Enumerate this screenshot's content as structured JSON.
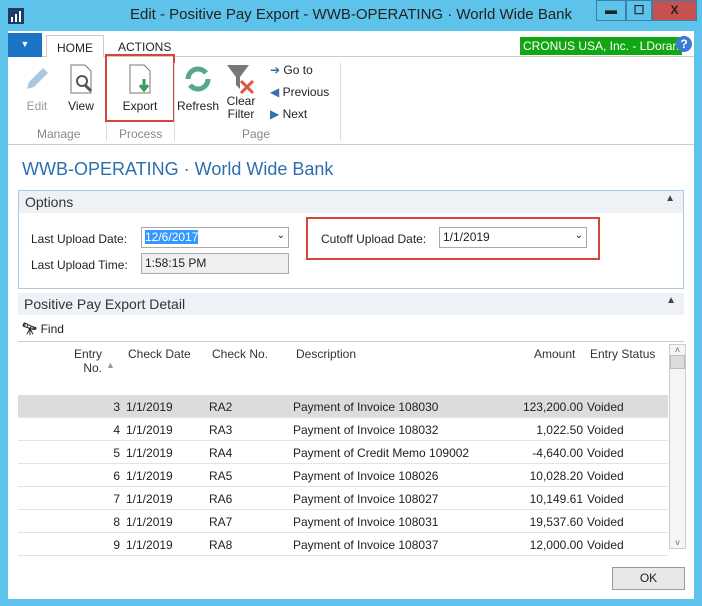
{
  "window": {
    "title": "Edit - Positive Pay Export - WWB-OPERATING · World Wide Bank",
    "minimize": "▬",
    "maximize": "☐",
    "close": "X"
  },
  "ribbon": {
    "tabs": [
      {
        "label": "HOME",
        "active": true
      },
      {
        "label": "ACTIONS",
        "active": false
      }
    ],
    "company": "CRONUS USA, Inc. - LDoran",
    "help": "?",
    "buttons": {
      "edit": "Edit",
      "view": "View",
      "export": "Export",
      "refresh": "Refresh",
      "clear_filter": "Clear Filter",
      "goto": "Go to",
      "previous": "Previous",
      "next": "Next"
    },
    "groups": {
      "manage": "Manage",
      "process": "Process",
      "page": "Page"
    }
  },
  "page_title": "WWB-OPERATING · World Wide Bank",
  "options": {
    "header": "Options",
    "last_upload_date_label": "Last Upload Date:",
    "last_upload_date": "12/6/2017",
    "last_upload_time_label": "Last Upload Time:",
    "last_upload_time": "1:58:15 PM",
    "cutoff_label": "Cutoff Upload Date:",
    "cutoff": "1/1/2019"
  },
  "detail": {
    "header": "Positive Pay Export Detail",
    "find": "Find",
    "columns": {
      "entry_no": "Entry No.",
      "check_date": "Check Date",
      "check_no": "Check No.",
      "description": "Description",
      "amount": "Amount",
      "status": "Entry Status"
    },
    "rows": [
      {
        "entry": "3",
        "date": "1/1/2019",
        "check": "RA2",
        "desc": "Payment of Invoice 108030",
        "amount": "123,200.00",
        "status": "Voided"
      },
      {
        "entry": "4",
        "date": "1/1/2019",
        "check": "RA3",
        "desc": "Payment of Invoice 108032",
        "amount": "1,022.50",
        "status": "Voided"
      },
      {
        "entry": "5",
        "date": "1/1/2019",
        "check": "RA4",
        "desc": "Payment of Credit Memo 109002",
        "amount": "-4,640.00",
        "status": "Voided"
      },
      {
        "entry": "6",
        "date": "1/1/2019",
        "check": "RA5",
        "desc": "Payment of Invoice 108026",
        "amount": "10,028.20",
        "status": "Voided"
      },
      {
        "entry": "7",
        "date": "1/1/2019",
        "check": "RA6",
        "desc": "Payment of Invoice 108027",
        "amount": "10,149.61",
        "status": "Voided"
      },
      {
        "entry": "8",
        "date": "1/1/2019",
        "check": "RA7",
        "desc": "Payment of Invoice 108031",
        "amount": "19,537.60",
        "status": "Voided"
      },
      {
        "entry": "9",
        "date": "1/1/2019",
        "check": "RA8",
        "desc": "Payment of Invoice 108037",
        "amount": "12,000.00",
        "status": "Voided"
      }
    ]
  },
  "ok": "OK"
}
